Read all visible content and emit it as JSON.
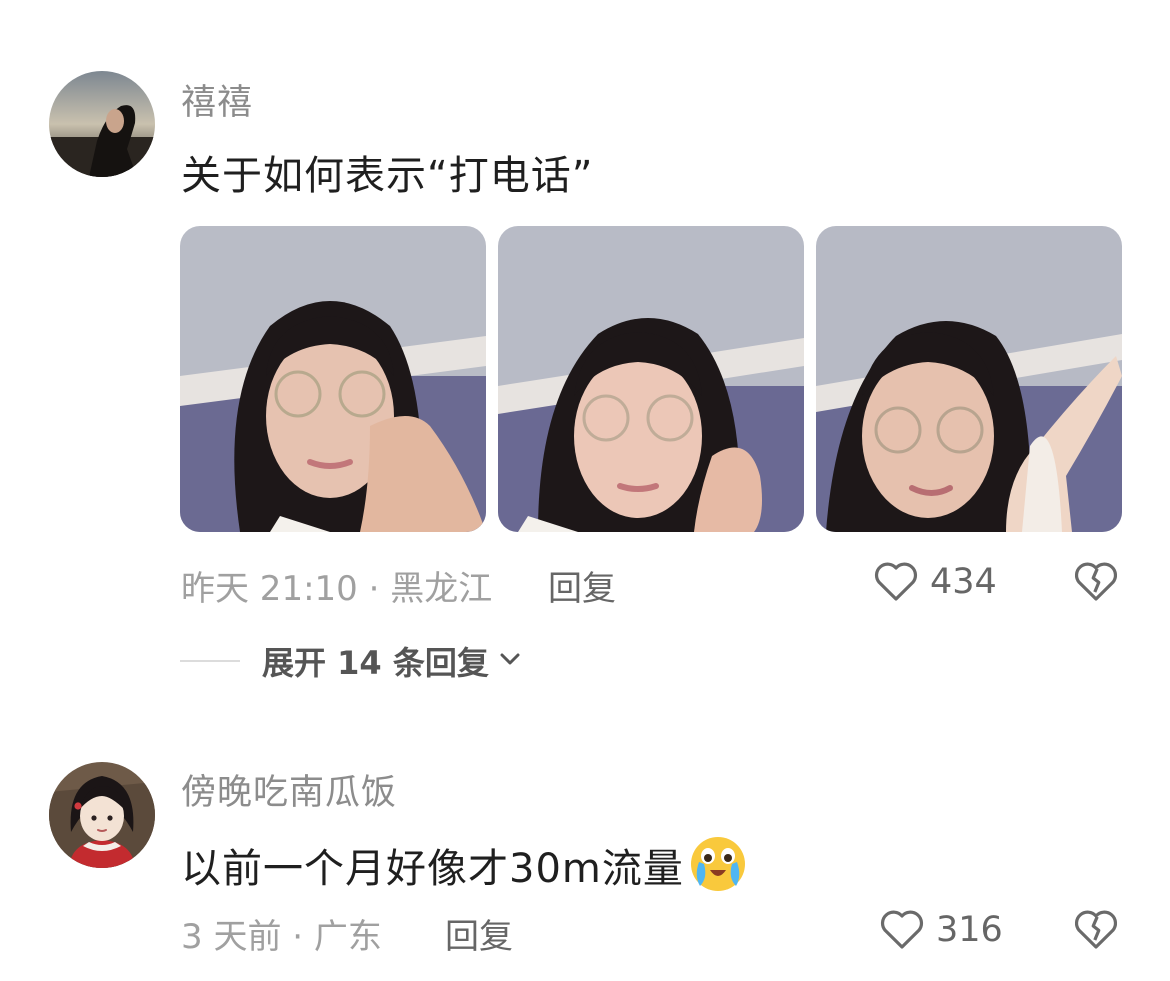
{
  "comments": [
    {
      "username": "禧禧",
      "text": "关于如何表示“打电话”",
      "time_location": "昨天 21:10 · 黑龙江",
      "reply_label": "回复",
      "likes": "434",
      "expand_label": "展开 14 条回复"
    },
    {
      "username": "傍晚吃南瓜饭",
      "text": "以前一个月好像才30m流量",
      "emoji": "crying-laughing-emoji",
      "time_location": "3 天前 · 广东",
      "reply_label": "回复",
      "likes": "316"
    }
  ],
  "icons": [
    "heart-outline-icon",
    "broken-heart-icon",
    "chevron-down-icon"
  ],
  "colors": {
    "username": "#8c8c8c",
    "meta": "#a0a0a0",
    "action": "#666666"
  }
}
